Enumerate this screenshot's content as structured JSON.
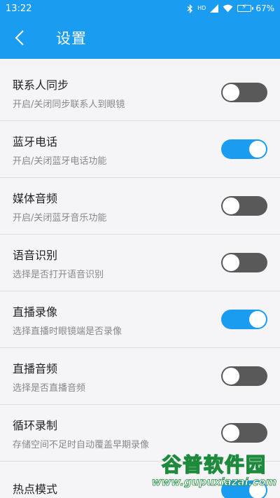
{
  "status_bar": {
    "time": "13:22",
    "network_label": "HD",
    "battery_percent": "67%"
  },
  "header": {
    "title": "设置",
    "back_icon": "chevron-left-icon"
  },
  "colors": {
    "accent": "#1a9cf0",
    "toggle_off": "#595959",
    "background": "#f5f5f7"
  },
  "settings": [
    {
      "title": "联系人同步",
      "subtitle": "开启/关闭同步联系人到眼镜",
      "enabled": false
    },
    {
      "title": "蓝牙电话",
      "subtitle": "开启/关闭蓝牙电话功能",
      "enabled": true
    },
    {
      "title": "媒体音频",
      "subtitle": "开启/关闭蓝牙音乐功能",
      "enabled": false
    },
    {
      "title": "语音识别",
      "subtitle": "选择是否打开语音识别",
      "enabled": false
    },
    {
      "title": "直播录像",
      "subtitle": "选择直播时眼镜端是否录像",
      "enabled": true
    },
    {
      "title": "直播音频",
      "subtitle": "选择是否直播音频",
      "enabled": false
    },
    {
      "title": "循环录制",
      "subtitle": "存储空间不足时自动覆盖早期录像",
      "enabled": false
    },
    {
      "title": "热点模式",
      "subtitle": "",
      "enabled": true
    }
  ],
  "watermark": {
    "main": "谷普软件园",
    "url": "www.gupuxiazai.com"
  }
}
